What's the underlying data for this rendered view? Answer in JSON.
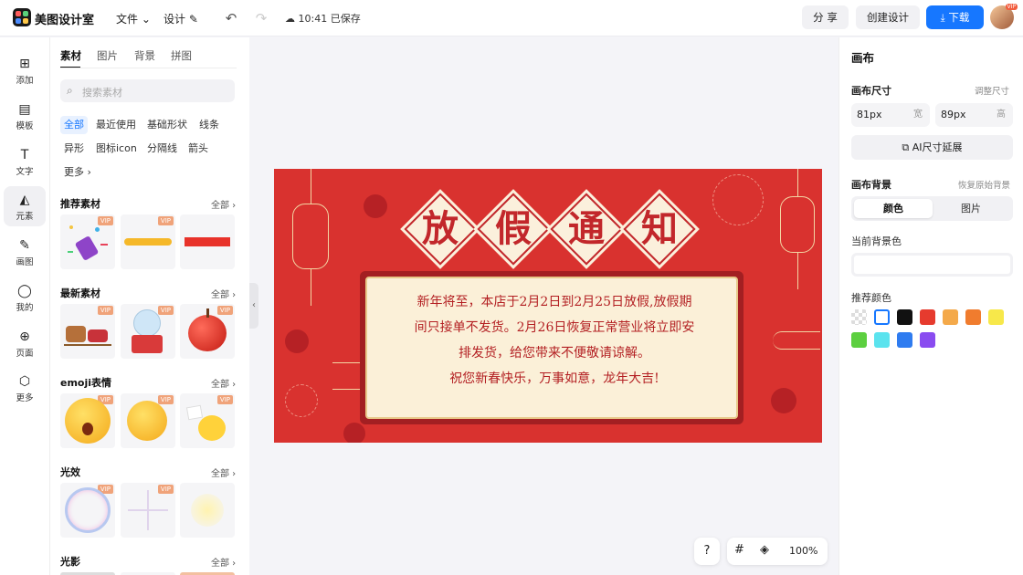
{
  "topbar": {
    "brand": "美图设计室",
    "menu_file": "文件",
    "menu_design": "设计",
    "save_status": "10:41 已保存",
    "share": "分 享",
    "create": "创建设计",
    "download": "下载",
    "avatar_badge": "VIP"
  },
  "leftnav": {
    "items": [
      {
        "label": "添加",
        "icon": "plus-icon"
      },
      {
        "label": "模板",
        "icon": "template-icon"
      },
      {
        "label": "文字",
        "icon": "text-icon"
      },
      {
        "label": "元素",
        "icon": "shapes-icon"
      },
      {
        "label": "画图",
        "icon": "draw-icon"
      },
      {
        "label": "我的",
        "icon": "user-icon"
      },
      {
        "label": "页面",
        "icon": "page-icon"
      },
      {
        "label": "更多",
        "icon": "cube-icon"
      }
    ],
    "active": "元素"
  },
  "panel": {
    "tabs": [
      "素材",
      "图片",
      "背景",
      "拼图"
    ],
    "search_placeholder": "搜索素材",
    "tags": [
      "全部",
      "最近使用",
      "基础形状",
      "线条",
      "异形",
      "图标icon",
      "分隔线",
      "箭头",
      "更多"
    ],
    "vip": "VIP",
    "all": "全部",
    "sections": [
      {
        "title": "推荐素材"
      },
      {
        "title": "最新素材"
      },
      {
        "title": "emoji表情"
      },
      {
        "title": "光效"
      },
      {
        "title": "光影"
      }
    ]
  },
  "canvas": {
    "title_chars": [
      "放",
      "假",
      "通",
      "知"
    ],
    "lines": [
      "新年将至，本店于2月2日到2月25日放假,放假期",
      "间只接单不发货。2月26日恢复正常营业将立即安",
      "排发货，给您带来不便敬请谅解。",
      "祝您新春快乐，万事如意，龙年大吉!"
    ],
    "bg_color": "#d9322f"
  },
  "right": {
    "title": "画布",
    "size_label": "画布尺寸",
    "resize_link": "调整尺寸",
    "width_value": "81px",
    "width_unit": "宽",
    "height_value": "89px",
    "height_unit": "高",
    "ai_extend": "AI尺寸延展",
    "bg_label": "画布背景",
    "restore_link": "恢复原始背景",
    "seg_color": "颜色",
    "seg_image": "图片",
    "current_bg_label": "当前背景色",
    "recommend_label": "推荐颜色",
    "swatches": [
      "transparent",
      "#ffffff",
      "#111111",
      "#e63b2e",
      "#f4a94a",
      "#f07c2e",
      "#f7e84a",
      "#5ccf3f",
      "#5be3ee",
      "#2f7cf0",
      "#8a4cf0"
    ]
  },
  "bottom": {
    "help": "?",
    "zoom": "100%"
  }
}
